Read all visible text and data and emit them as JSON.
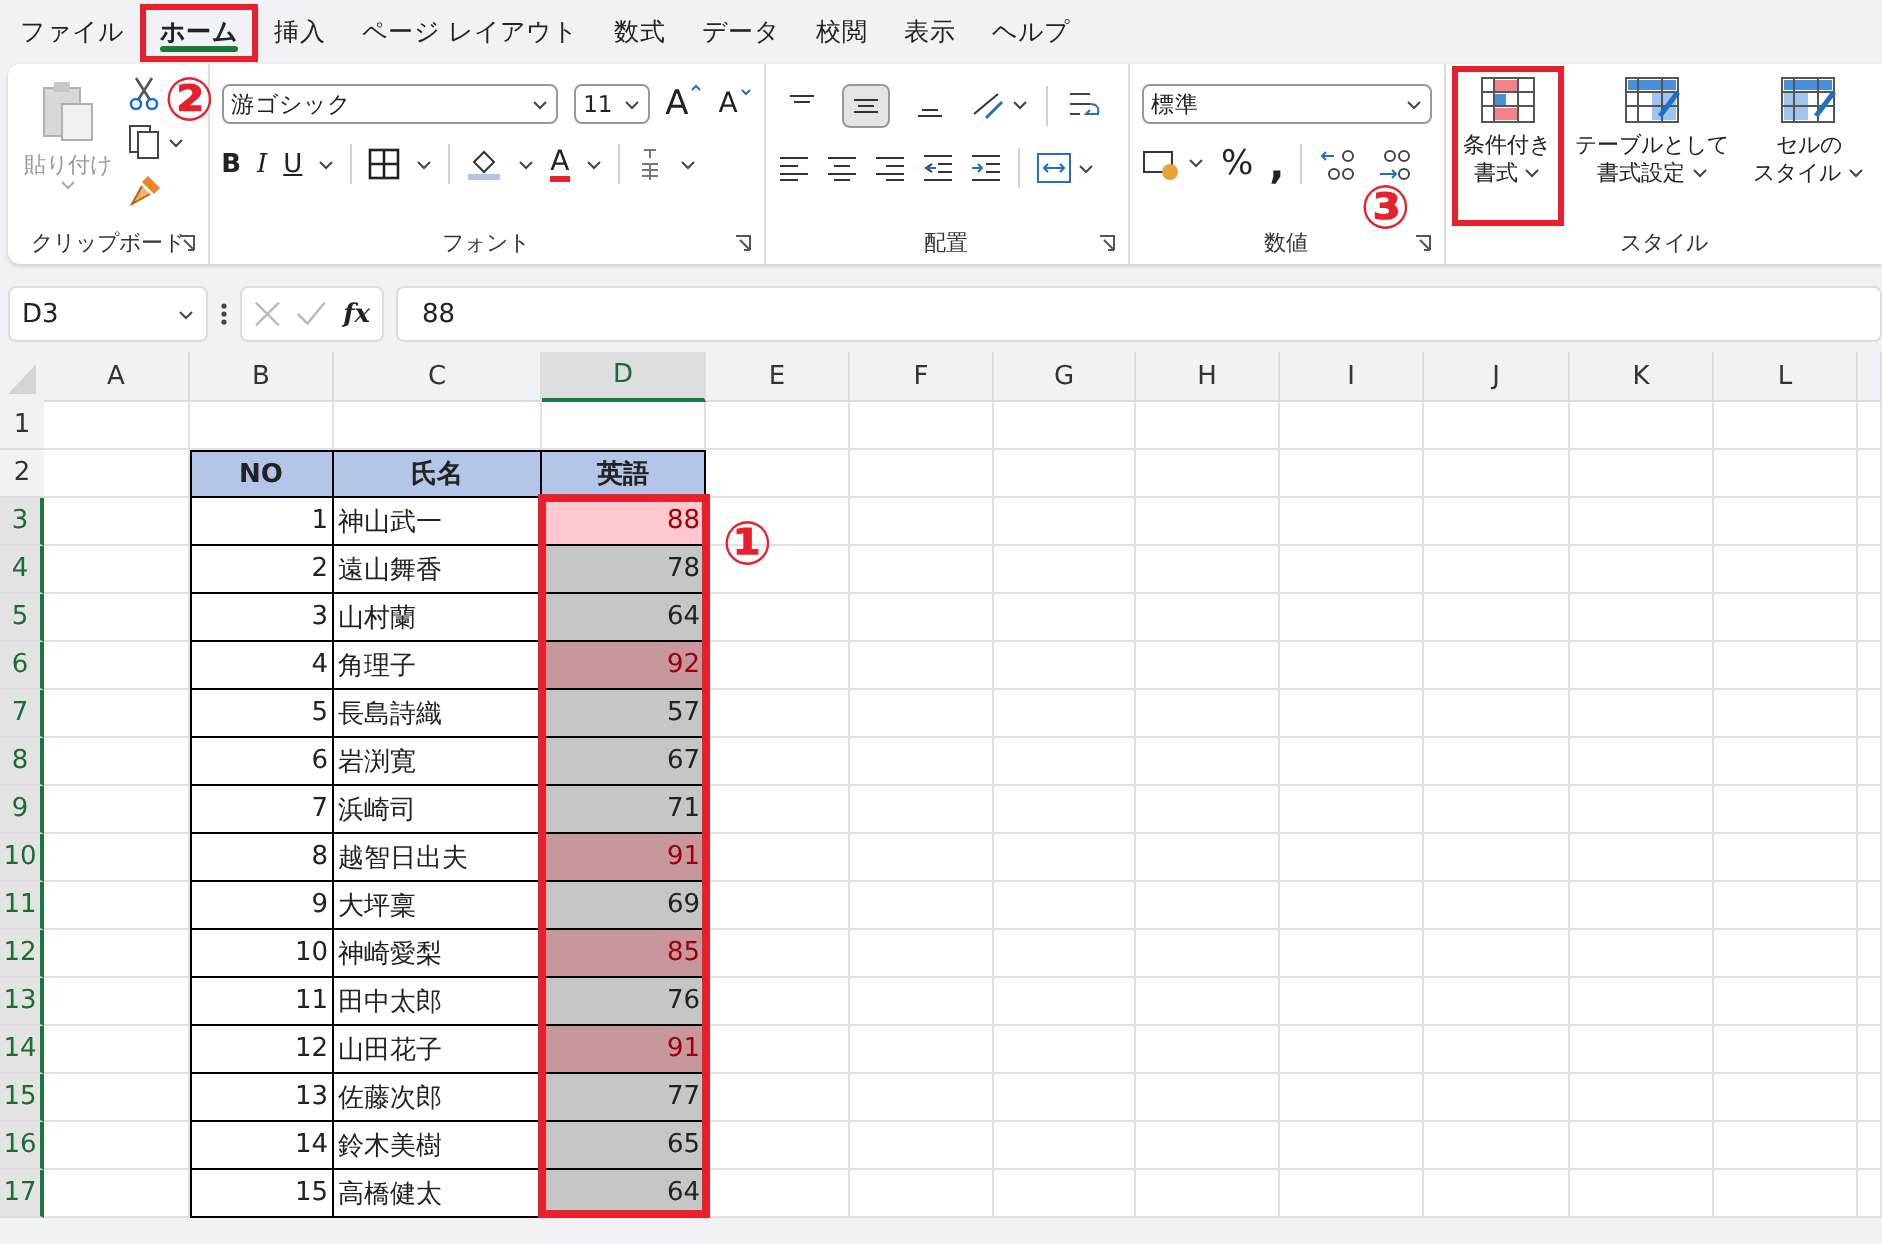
{
  "menu_tabs": [
    {
      "label": "ファイル",
      "selected": false,
      "framed": false
    },
    {
      "label": "ホーム",
      "selected": true,
      "framed": true
    },
    {
      "label": "挿入",
      "selected": false,
      "framed": false
    },
    {
      "label": "ページ レイアウト",
      "selected": false,
      "framed": false
    },
    {
      "label": "数式",
      "selected": false,
      "framed": false
    },
    {
      "label": "データ",
      "selected": false,
      "framed": false
    },
    {
      "label": "校閲",
      "selected": false,
      "framed": false
    },
    {
      "label": "表示",
      "selected": false,
      "framed": false
    },
    {
      "label": "ヘルプ",
      "selected": false,
      "framed": false
    }
  ],
  "ribbon": {
    "clipboard": {
      "label": "クリップボード",
      "paste": "貼り付け"
    },
    "font": {
      "label": "フォント",
      "font_name": "游ゴシック",
      "font_size": "11",
      "grow": "A",
      "shrink": "A",
      "bold": "B",
      "italic": "I",
      "underline": "U",
      "font_color": "A"
    },
    "alignment": {
      "label": "配置",
      "vertical": [
        {
          "selected": false
        },
        {
          "selected": true
        },
        {
          "selected": false
        }
      ]
    },
    "number": {
      "label": "数値",
      "format": "標準",
      "percent": "%",
      "comma": ","
    },
    "styles": {
      "label": "スタイル",
      "buttons": [
        {
          "lines": [
            "条件付き",
            "書式"
          ],
          "framed": true
        },
        {
          "lines": [
            "テーブルとして",
            "書式設定"
          ],
          "framed": false
        },
        {
          "lines": [
            "セルの",
            "スタイル"
          ],
          "framed": false
        }
      ]
    }
  },
  "formula_bar": {
    "name_box": "D3",
    "fx": "fx",
    "formula": "88"
  },
  "columns": [
    {
      "label": "A",
      "selected": false
    },
    {
      "label": "B",
      "selected": false
    },
    {
      "label": "C",
      "selected": false
    },
    {
      "label": "D",
      "selected": true
    },
    {
      "label": "E",
      "selected": false
    },
    {
      "label": "F",
      "selected": false
    },
    {
      "label": "G",
      "selected": false
    },
    {
      "label": "H",
      "selected": false
    },
    {
      "label": "I",
      "selected": false
    },
    {
      "label": "J",
      "selected": false
    },
    {
      "label": "K",
      "selected": false
    },
    {
      "label": "L",
      "selected": false
    }
  ],
  "row_numbers": [
    {
      "label": "1",
      "selected": false
    },
    {
      "label": "2",
      "selected": false
    },
    {
      "label": "3",
      "selected": true
    },
    {
      "label": "4",
      "selected": true
    },
    {
      "label": "5",
      "selected": true
    },
    {
      "label": "6",
      "selected": true
    },
    {
      "label": "7",
      "selected": true
    },
    {
      "label": "8",
      "selected": true
    },
    {
      "label": "9",
      "selected": true
    },
    {
      "label": "10",
      "selected": true
    },
    {
      "label": "11",
      "selected": true
    },
    {
      "label": "12",
      "selected": true
    },
    {
      "label": "13",
      "selected": true
    },
    {
      "label": "14",
      "selected": true
    },
    {
      "label": "15",
      "selected": true
    },
    {
      "label": "16",
      "selected": true
    },
    {
      "label": "17",
      "selected": true
    }
  ],
  "table": {
    "header": [
      "NO",
      "氏名",
      "英語"
    ],
    "range_frame": true,
    "rows": [
      {
        "no": "1",
        "name": "神山武一",
        "score": "88",
        "highlighted": true,
        "active": true
      },
      {
        "no": "2",
        "name": "遠山舞香",
        "score": "78",
        "highlighted": false,
        "active": false
      },
      {
        "no": "3",
        "name": "山村蘭",
        "score": "64",
        "highlighted": false,
        "active": false
      },
      {
        "no": "4",
        "name": "角理子",
        "score": "92",
        "highlighted": true,
        "active": false
      },
      {
        "no": "5",
        "name": "長島詩織",
        "score": "57",
        "highlighted": false,
        "active": false
      },
      {
        "no": "6",
        "name": "岩渕寛",
        "score": "67",
        "highlighted": false,
        "active": false
      },
      {
        "no": "7",
        "name": "浜崎司",
        "score": "71",
        "highlighted": false,
        "active": false
      },
      {
        "no": "8",
        "name": "越智日出夫",
        "score": "91",
        "highlighted": true,
        "active": false
      },
      {
        "no": "9",
        "name": "大坪稟",
        "score": "69",
        "highlighted": false,
        "active": false
      },
      {
        "no": "10",
        "name": "神崎愛梨",
        "score": "85",
        "highlighted": true,
        "active": false
      },
      {
        "no": "11",
        "name": "田中太郎",
        "score": "76",
        "highlighted": false,
        "active": false
      },
      {
        "no": "12",
        "name": "山田花子",
        "score": "91",
        "highlighted": true,
        "active": false
      },
      {
        "no": "13",
        "name": "佐藤次郎",
        "score": "77",
        "highlighted": false,
        "active": false
      },
      {
        "no": "14",
        "name": "鈴木美樹",
        "score": "65",
        "highlighted": false,
        "active": false
      },
      {
        "no": "15",
        "name": "高橋健太",
        "score": "64",
        "highlighted": false,
        "active": false
      }
    ]
  },
  "markers": [
    "①",
    "②",
    "③"
  ]
}
